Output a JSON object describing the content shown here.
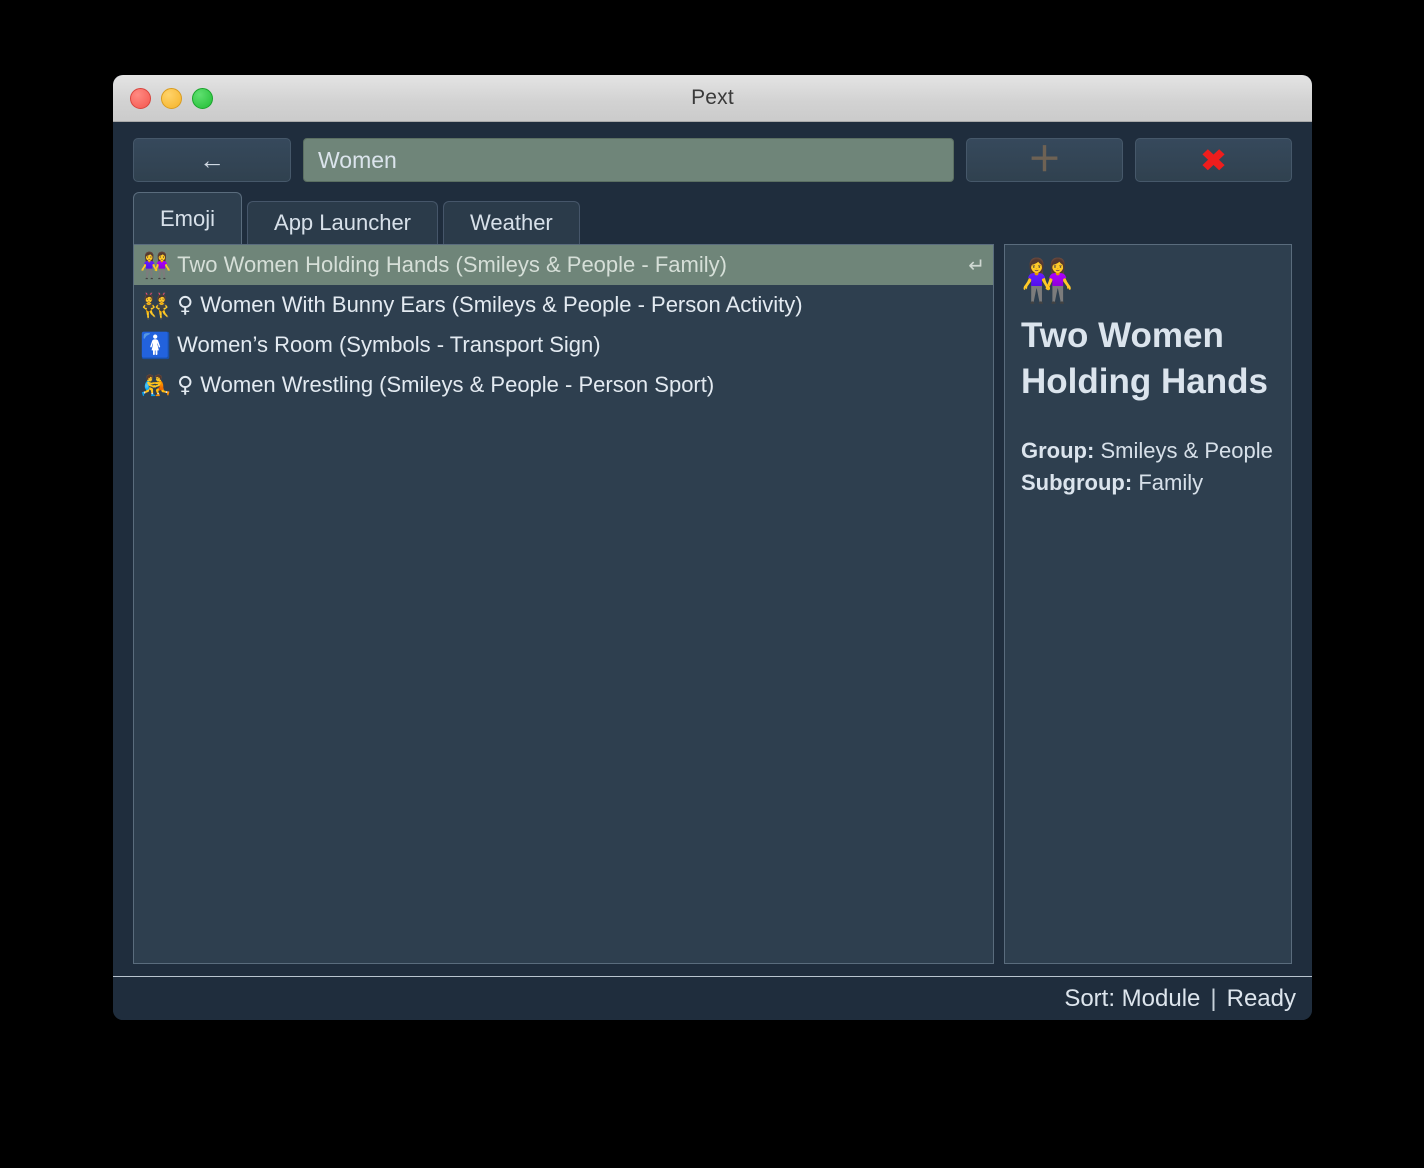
{
  "window": {
    "title": "Pext",
    "traffic_lights": [
      {
        "name": "close",
        "color": "#f4574f"
      },
      {
        "name": "minimize",
        "color": "#f5b32a"
      },
      {
        "name": "maximize",
        "color": "#22bd35"
      }
    ]
  },
  "toolbar": {
    "back_icon": "arrow-left-icon",
    "back_glyph": "←",
    "add_icon": "plus-icon",
    "add_glyph": "＋",
    "close_icon": "close-x-icon",
    "close_glyph": "✖",
    "search": {
      "value": "Women",
      "placeholder": "Type to search"
    }
  },
  "tabs": [
    {
      "label": "Emoji",
      "active": true
    },
    {
      "label": "App Launcher",
      "active": false
    },
    {
      "label": "Weather",
      "active": false
    }
  ],
  "list": {
    "items": [
      {
        "emoji": "👭",
        "sign": "",
        "label": "Two Women Holding Hands (Smileys & People - Family)",
        "selected": true,
        "enter_glyph": "↵"
      },
      {
        "emoji": "👯",
        "sign": "♀",
        "label": "Women With Bunny Ears (Smileys & People - Person Activity)",
        "selected": false,
        "enter_glyph": ""
      },
      {
        "emoji": "🚺",
        "sign": "",
        "label": "Women’s Room (Symbols - Transport Sign)",
        "selected": false,
        "enter_glyph": ""
      },
      {
        "emoji": "🤼",
        "sign": "♀",
        "label": "Women Wrestling (Smileys & People - Person Sport)",
        "selected": false,
        "enter_glyph": ""
      }
    ]
  },
  "detail": {
    "emoji": "👭",
    "title": "Two Women Holding Hands",
    "group_label": "Group:",
    "group_value": "Smileys & People",
    "subgroup_label": "Subgroup:",
    "subgroup_value": "Family"
  },
  "status": {
    "sort": "Sort: Module",
    "separator": "|",
    "state": "Ready"
  },
  "colors": {
    "window_bg": "#1f2d3d",
    "panel_bg": "#2e3f4f",
    "selection": "#6f8579",
    "search_bg": "#6f8579",
    "text": "#dbe4ed",
    "accent_red": "#ef1d1d"
  }
}
